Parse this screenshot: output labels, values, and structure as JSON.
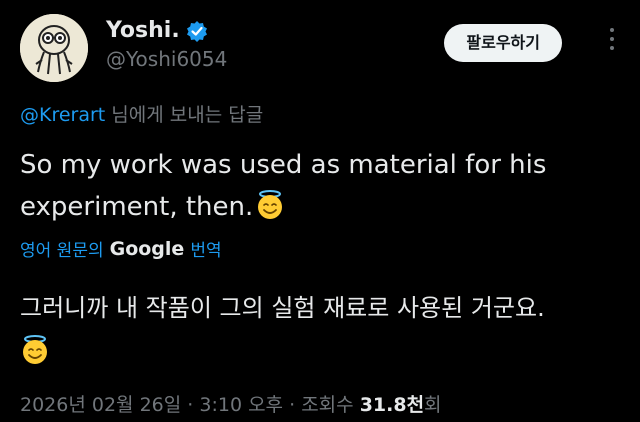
{
  "user": {
    "display_name": "Yoshi.",
    "handle": "@Yoshi6054",
    "follow_label": "팔로우하기"
  },
  "reply": {
    "mention": "@Krerart",
    "suffix": " 님에게 보내는 답글"
  },
  "tweet": {
    "text": "So my work was used as material for his experiment, then."
  },
  "translation": {
    "lang_label": "영어 원문의",
    "provider": "Google",
    "action": "번역",
    "text": "그러니까 내 작품이 그의 실험 재료로 사용된 거군요."
  },
  "meta": {
    "date": "2026년 02월 26일",
    "time": "3:10 오후",
    "views_label": "조회수",
    "views_count": "31.8천",
    "views_suffix": "회",
    "separator": "·"
  },
  "icons": {
    "verified": "verified-badge-icon",
    "emoji": "smiling-face-with-halo-emoji",
    "more": "more-options-icon"
  },
  "colors": {
    "background": "#000000",
    "text": "#e7e9ea",
    "muted": "#71767b",
    "accent": "#1d9bf0"
  }
}
